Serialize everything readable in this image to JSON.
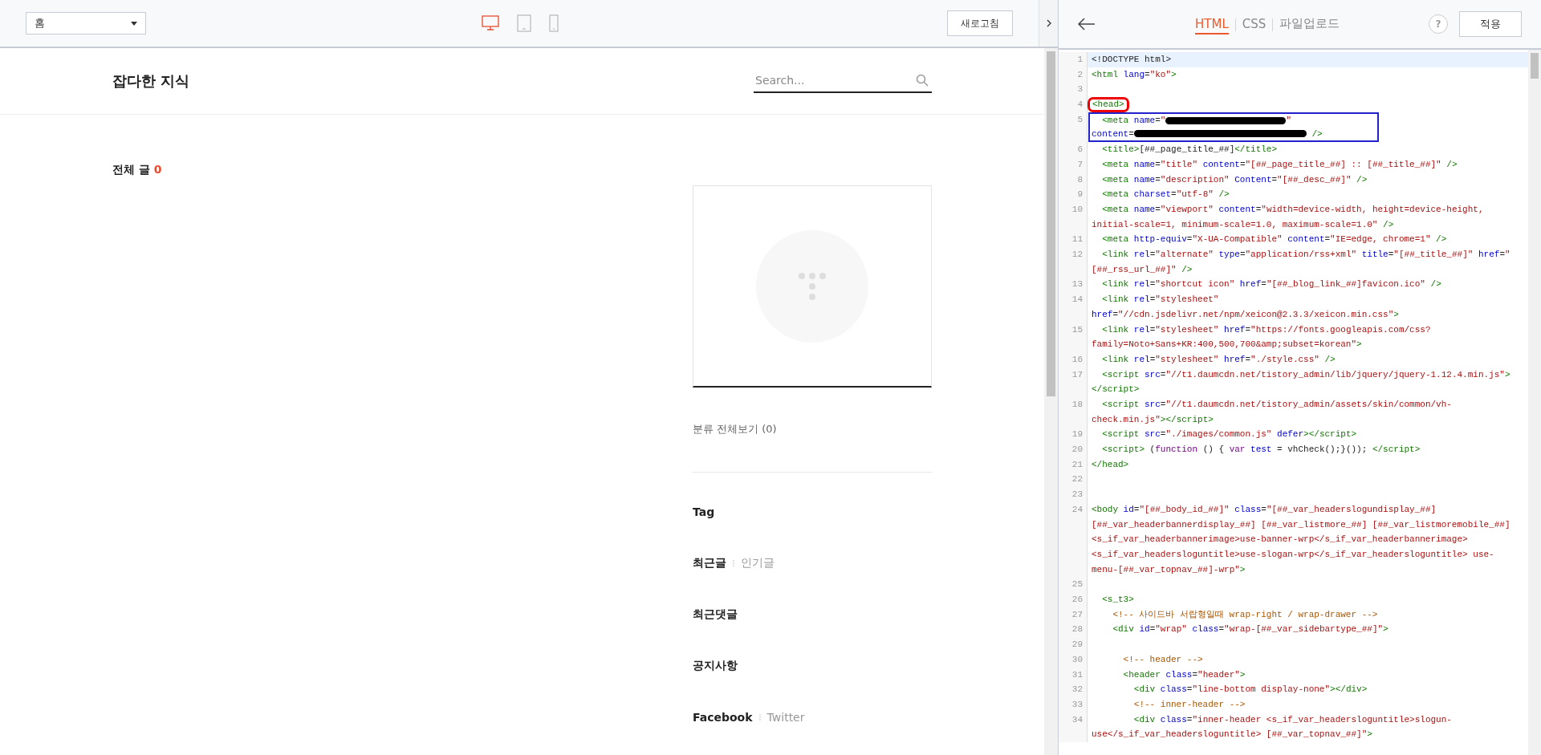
{
  "preview_toolbar": {
    "page_select": {
      "value": "홈"
    },
    "devices": [
      {
        "kind": "desktop",
        "selected": true
      },
      {
        "kind": "tablet",
        "selected": false
      },
      {
        "kind": "mobile",
        "selected": false
      }
    ],
    "refresh_button": "새로고침"
  },
  "blog": {
    "title": "잡다한 지식",
    "search": {
      "placeholder": "Search..."
    },
    "post_count": {
      "label": "전체 글",
      "count": "0"
    },
    "sidebar": {
      "category_link": "분류 전체보기 (0)",
      "sections": [
        {
          "tabs": [
            {
              "label": "Tag",
              "selected": true
            }
          ]
        },
        {
          "tabs": [
            {
              "label": "최근글",
              "selected": true
            },
            {
              "label": "인기글",
              "selected": false
            }
          ]
        },
        {
          "tabs": [
            {
              "label": "최근댓글",
              "selected": true
            }
          ]
        },
        {
          "tabs": [
            {
              "label": "공지사항",
              "selected": true
            }
          ]
        },
        {
          "tabs": [
            {
              "label": "Facebook",
              "selected": true
            },
            {
              "label": "Twitter",
              "selected": false
            }
          ]
        }
      ]
    }
  },
  "editor": {
    "tabs": [
      {
        "label": "HTML",
        "selected": true
      },
      {
        "label": "CSS",
        "selected": false
      },
      {
        "label": "파일업로드",
        "selected": false
      }
    ],
    "help_button": "?",
    "apply_button": "적용",
    "lines": [
      {
        "number": "1",
        "current": true,
        "circled": false,
        "boxed": false,
        "rows": [
          {
            "tokens": [
              {
                "kind": "plain",
                "text": "<!DOCTYPE html>"
              }
            ]
          }
        ]
      },
      {
        "number": "2",
        "current": false,
        "circled": false,
        "boxed": false,
        "rows": [
          {
            "tokens": [
              {
                "kind": "tag",
                "text": "<html"
              },
              {
                "kind": "attr",
                "text": " lang"
              },
              {
                "kind": "plain",
                "text": "="
              },
              {
                "kind": "string",
                "text": "\"ko\""
              },
              {
                "kind": "tag",
                "text": ">"
              }
            ]
          }
        ]
      },
      {
        "number": "3",
        "current": false,
        "circled": false,
        "boxed": false,
        "rows": [
          {}
        ]
      },
      {
        "number": "4",
        "current": false,
        "circled": true,
        "boxed": false,
        "rows": [
          {
            "tokens": [
              {
                "kind": "tag",
                "text": "<head>"
              }
            ]
          }
        ]
      },
      {
        "number": "5",
        "current": false,
        "circled": false,
        "boxed": true,
        "rows": [
          {
            "tokens": [
              {
                "kind": "tag",
                "text": "  <meta"
              },
              {
                "kind": "attr",
                "text": " name"
              },
              {
                "kind": "plain",
                "text": "="
              },
              {
                "kind": "string",
                "text": "\""
              },
              {
                "kind": "redaction"
              },
              {
                "kind": "string",
                "text": "\""
              }
            ]
          },
          {
            "tokens": [
              {
                "kind": "attr",
                "text": "content"
              },
              {
                "kind": "plain",
                "text": "="
              },
              {
                "kind": "redaction"
              },
              {
                "kind": "tag",
                "text": " />"
              }
            ]
          }
        ]
      },
      {
        "number": "6",
        "current": false,
        "circled": false,
        "boxed": false,
        "rows": [
          {
            "tokens": [
              {
                "kind": "tag",
                "text": "  <title>"
              },
              {
                "kind": "plain",
                "text": "[##_page_title_##]"
              },
              {
                "kind": "tag",
                "text": "</title>"
              }
            ]
          }
        ]
      },
      {
        "number": "7",
        "current": false,
        "circled": false,
        "boxed": false,
        "rows": [
          {
            "tokens": [
              {
                "kind": "tag",
                "text": "  <meta"
              },
              {
                "kind": "attr",
                "text": " name"
              },
              {
                "kind": "plain",
                "text": "="
              },
              {
                "kind": "string",
                "text": "\"title\""
              },
              {
                "kind": "attr",
                "text": " content"
              },
              {
                "kind": "plain",
                "text": "="
              },
              {
                "kind": "string",
                "text": "\"[##_page_title_##] :: [##_title_##]\""
              },
              {
                "kind": "tag",
                "text": " />"
              }
            ]
          }
        ]
      },
      {
        "number": "8",
        "current": false,
        "circled": false,
        "boxed": false,
        "rows": [
          {
            "tokens": [
              {
                "kind": "tag",
                "text": "  <meta"
              },
              {
                "kind": "attr",
                "text": " name"
              },
              {
                "kind": "plain",
                "text": "="
              },
              {
                "kind": "string",
                "text": "\"description\""
              },
              {
                "kind": "attr",
                "text": " Content"
              },
              {
                "kind": "plain",
                "text": "="
              },
              {
                "kind": "string",
                "text": "\"[##_desc_##]\""
              },
              {
                "kind": "tag",
                "text": " />"
              }
            ]
          }
        ]
      },
      {
        "number": "9",
        "current": false,
        "circled": false,
        "boxed": false,
        "rows": [
          {
            "tokens": [
              {
                "kind": "tag",
                "text": "  <meta"
              },
              {
                "kind": "attr",
                "text": " charset"
              },
              {
                "kind": "plain",
                "text": "="
              },
              {
                "kind": "string",
                "text": "\"utf-8\""
              },
              {
                "kind": "tag",
                "text": " />"
              }
            ]
          }
        ]
      },
      {
        "number": "10",
        "current": false,
        "circled": false,
        "boxed": false,
        "rows": [
          {
            "tokens": [
              {
                "kind": "tag",
                "text": "  <meta"
              },
              {
                "kind": "attr",
                "text": " name"
              },
              {
                "kind": "plain",
                "text": "="
              },
              {
                "kind": "string",
                "text": "\"viewport\""
              },
              {
                "kind": "attr",
                "text": " content"
              },
              {
                "kind": "plain",
                "text": "="
              },
              {
                "kind": "string",
                "text": "\"width=device-width, height=device-height,"
              }
            ]
          },
          {
            "tokens": [
              {
                "kind": "string",
                "text": "initial-scale=1, minimum-scale=1.0, maximum-scale=1.0\""
              },
              {
                "kind": "tag",
                "text": " />"
              }
            ]
          }
        ]
      },
      {
        "number": "11",
        "current": false,
        "circled": false,
        "boxed": false,
        "rows": [
          {
            "tokens": [
              {
                "kind": "tag",
                "text": "  <meta"
              },
              {
                "kind": "attr",
                "text": " http-equiv"
              },
              {
                "kind": "plain",
                "text": "="
              },
              {
                "kind": "string",
                "text": "\"X-UA-Compatible\""
              },
              {
                "kind": "attr",
                "text": " content"
              },
              {
                "kind": "plain",
                "text": "="
              },
              {
                "kind": "string",
                "text": "\"IE=edge, chrome=1\""
              },
              {
                "kind": "tag",
                "text": " />"
              }
            ]
          }
        ]
      },
      {
        "number": "12",
        "current": false,
        "circled": false,
        "boxed": false,
        "rows": [
          {
            "tokens": [
              {
                "kind": "tag",
                "text": "  <link"
              },
              {
                "kind": "attr",
                "text": " rel"
              },
              {
                "kind": "plain",
                "text": "="
              },
              {
                "kind": "string",
                "text": "\"alternate\""
              },
              {
                "kind": "attr",
                "text": " type"
              },
              {
                "kind": "plain",
                "text": "="
              },
              {
                "kind": "string",
                "text": "\"application/rss+xml\""
              },
              {
                "kind": "attr",
                "text": " title"
              },
              {
                "kind": "plain",
                "text": "="
              },
              {
                "kind": "string",
                "text": "\"[##_title_##]\""
              },
              {
                "kind": "attr",
                "text": " href"
              },
              {
                "kind": "plain",
                "text": "="
              },
              {
                "kind": "string",
                "text": "\""
              }
            ]
          },
          {
            "tokens": [
              {
                "kind": "string",
                "text": "[##_rss_url_##]\""
              },
              {
                "kind": "tag",
                "text": " />"
              }
            ]
          }
        ]
      },
      {
        "number": "13",
        "current": false,
        "circled": false,
        "boxed": false,
        "rows": [
          {
            "tokens": [
              {
                "kind": "tag",
                "text": "  <link"
              },
              {
                "kind": "attr",
                "text": " rel"
              },
              {
                "kind": "plain",
                "text": "="
              },
              {
                "kind": "string",
                "text": "\"shortcut icon\""
              },
              {
                "kind": "attr",
                "text": " href"
              },
              {
                "kind": "plain",
                "text": "="
              },
              {
                "kind": "string",
                "text": "\"[##_blog_link_##]favicon.ico\""
              },
              {
                "kind": "tag",
                "text": " />"
              }
            ]
          }
        ]
      },
      {
        "number": "14",
        "current": false,
        "circled": false,
        "boxed": false,
        "rows": [
          {
            "tokens": [
              {
                "kind": "tag",
                "text": "  <link"
              },
              {
                "kind": "attr",
                "text": " rel"
              },
              {
                "kind": "plain",
                "text": "="
              },
              {
                "kind": "string",
                "text": "\"stylesheet\""
              }
            ]
          },
          {
            "tokens": [
              {
                "kind": "attr",
                "text": "href"
              },
              {
                "kind": "plain",
                "text": "="
              },
              {
                "kind": "string",
                "text": "\"//cdn.jsdelivr.net/npm/xeicon@2.3.3/xeicon.min.css\""
              },
              {
                "kind": "tag",
                "text": ">"
              }
            ]
          }
        ]
      },
      {
        "number": "15",
        "current": false,
        "circled": false,
        "boxed": false,
        "rows": [
          {
            "tokens": [
              {
                "kind": "tag",
                "text": "  <link"
              },
              {
                "kind": "attr",
                "text": " rel"
              },
              {
                "kind": "plain",
                "text": "="
              },
              {
                "kind": "string",
                "text": "\"stylesheet\""
              },
              {
                "kind": "attr",
                "text": " href"
              },
              {
                "kind": "plain",
                "text": "="
              },
              {
                "kind": "string",
                "text": "\"https://fonts.googleapis.com/css?"
              }
            ]
          },
          {
            "tokens": [
              {
                "kind": "string",
                "text": "family=Noto+Sans+KR:400,500,700&amp;subset=korean\""
              },
              {
                "kind": "tag",
                "text": ">"
              }
            ]
          }
        ]
      },
      {
        "number": "16",
        "current": false,
        "circled": false,
        "boxed": false,
        "rows": [
          {
            "tokens": [
              {
                "kind": "tag",
                "text": "  <link"
              },
              {
                "kind": "attr",
                "text": " rel"
              },
              {
                "kind": "plain",
                "text": "="
              },
              {
                "kind": "string",
                "text": "\"stylesheet\""
              },
              {
                "kind": "attr",
                "text": " href"
              },
              {
                "kind": "plain",
                "text": "="
              },
              {
                "kind": "string",
                "text": "\"./style.css\""
              },
              {
                "kind": "tag",
                "text": " />"
              }
            ]
          }
        ]
      },
      {
        "number": "17",
        "current": false,
        "circled": false,
        "boxed": false,
        "rows": [
          {
            "tokens": [
              {
                "kind": "tag",
                "text": "  <script"
              },
              {
                "kind": "attr",
                "text": " src"
              },
              {
                "kind": "plain",
                "text": "="
              },
              {
                "kind": "string",
                "text": "\"//t1.daumcdn.net/tistory_admin/lib/jquery/jquery-1.12.4.min.js\""
              },
              {
                "kind": "tag",
                "text": ">"
              }
            ]
          },
          {
            "tokens": [
              {
                "kind": "tag",
                "text": "</script>"
              }
            ]
          }
        ]
      },
      {
        "number": "18",
        "current": false,
        "circled": false,
        "boxed": false,
        "rows": [
          {
            "tokens": [
              {
                "kind": "tag",
                "text": "  <script"
              },
              {
                "kind": "attr",
                "text": " src"
              },
              {
                "kind": "plain",
                "text": "="
              },
              {
                "kind": "string",
                "text": "\"//t1.daumcdn.net/tistory_admin/assets/skin/common/vh-"
              }
            ]
          },
          {
            "tokens": [
              {
                "kind": "string",
                "text": "check.min.js\""
              },
              {
                "kind": "tag",
                "text": "></script>"
              }
            ]
          }
        ]
      },
      {
        "number": "19",
        "current": false,
        "circled": false,
        "boxed": false,
        "rows": [
          {
            "tokens": [
              {
                "kind": "tag",
                "text": "  <script"
              },
              {
                "kind": "attr",
                "text": " src"
              },
              {
                "kind": "plain",
                "text": "="
              },
              {
                "kind": "string",
                "text": "\"./images/common.js\""
              },
              {
                "kind": "attr",
                "text": " defer"
              },
              {
                "kind": "tag",
                "text": "></script>"
              }
            ]
          }
        ]
      },
      {
        "number": "20",
        "current": false,
        "circled": false,
        "boxed": false,
        "rows": [
          {
            "tokens": [
              {
                "kind": "tag",
                "text": "  <script>"
              },
              {
                "kind": "plain",
                "text": " ("
              },
              {
                "kind": "keyword",
                "text": "function"
              },
              {
                "kind": "plain",
                "text": " () { "
              },
              {
                "kind": "keyword",
                "text": "var"
              },
              {
                "kind": "attr",
                "text": " test"
              },
              {
                "kind": "plain",
                "text": " = vhCheck();}()); "
              },
              {
                "kind": "tag",
                "text": "</script>"
              }
            ]
          }
        ]
      },
      {
        "number": "21",
        "current": false,
        "circled": false,
        "boxed": false,
        "rows": [
          {
            "tokens": [
              {
                "kind": "tag",
                "text": "</head>"
              }
            ]
          }
        ]
      },
      {
        "number": "22",
        "current": false,
        "circled": false,
        "boxed": false,
        "rows": [
          {}
        ]
      },
      {
        "number": "23",
        "current": false,
        "circled": false,
        "boxed": false,
        "rows": [
          {}
        ]
      },
      {
        "number": "24",
        "current": false,
        "circled": false,
        "boxed": false,
        "rows": [
          {
            "tokens": [
              {
                "kind": "tag",
                "text": "<body"
              },
              {
                "kind": "attr",
                "text": " id"
              },
              {
                "kind": "plain",
                "text": "="
              },
              {
                "kind": "string",
                "text": "\"[##_body_id_##]\""
              },
              {
                "kind": "attr",
                "text": " class"
              },
              {
                "kind": "plain",
                "text": "="
              },
              {
                "kind": "string",
                "text": "\"[##_var_headerslogundisplay_##]"
              }
            ]
          },
          {
            "tokens": [
              {
                "kind": "string",
                "text": "[##_var_headerbannerdisplay_##] [##_var_listmore_##] [##_var_listmoremobile_##]"
              }
            ]
          },
          {
            "tokens": [
              {
                "kind": "string",
                "text": "<s_if_var_headerbannerimage>use-banner-wrp</s_if_var_headerbannerimage>"
              }
            ]
          },
          {
            "tokens": [
              {
                "kind": "string",
                "text": "<s_if_var_headersloguntitle>use-slogan-wrp</s_if_var_headersloguntitle> use-"
              }
            ]
          },
          {
            "tokens": [
              {
                "kind": "string",
                "text": "menu-[##_var_topnav_##]-wrp\""
              },
              {
                "kind": "tag",
                "text": ">"
              }
            ]
          }
        ]
      },
      {
        "number": "25",
        "current": false,
        "circled": false,
        "boxed": false,
        "rows": [
          {}
        ]
      },
      {
        "number": "26",
        "current": false,
        "circled": false,
        "boxed": false,
        "rows": [
          {
            "tokens": [
              {
                "kind": "tag",
                "text": "  <s_t3>"
              }
            ]
          }
        ]
      },
      {
        "number": "27",
        "current": false,
        "circled": false,
        "boxed": false,
        "rows": [
          {
            "tokens": [
              {
                "kind": "comment",
                "text": "    <!-- 사이드바 서랍형일때 wrap-right / wrap-drawer -->"
              }
            ]
          }
        ]
      },
      {
        "number": "28",
        "current": false,
        "circled": false,
        "boxed": false,
        "rows": [
          {
            "tokens": [
              {
                "kind": "tag",
                "text": "    <div"
              },
              {
                "kind": "attr",
                "text": " id"
              },
              {
                "kind": "plain",
                "text": "="
              },
              {
                "kind": "string",
                "text": "\"wrap\""
              },
              {
                "kind": "attr",
                "text": " class"
              },
              {
                "kind": "plain",
                "text": "="
              },
              {
                "kind": "string",
                "text": "\"wrap-[##_var_sidebartype_##]\""
              },
              {
                "kind": "tag",
                "text": ">"
              }
            ]
          }
        ]
      },
      {
        "number": "29",
        "current": false,
        "circled": false,
        "boxed": false,
        "rows": [
          {}
        ]
      },
      {
        "number": "30",
        "current": false,
        "circled": false,
        "boxed": false,
        "rows": [
          {
            "tokens": [
              {
                "kind": "comment",
                "text": "      <!-- header -->"
              }
            ]
          }
        ]
      },
      {
        "number": "31",
        "current": false,
        "circled": false,
        "boxed": false,
        "rows": [
          {
            "tokens": [
              {
                "kind": "tag",
                "text": "      <header"
              },
              {
                "kind": "attr",
                "text": " class"
              },
              {
                "kind": "plain",
                "text": "="
              },
              {
                "kind": "string",
                "text": "\"header\""
              },
              {
                "kind": "tag",
                "text": ">"
              }
            ]
          }
        ]
      },
      {
        "number": "32",
        "current": false,
        "circled": false,
        "boxed": false,
        "rows": [
          {
            "tokens": [
              {
                "kind": "tag",
                "text": "        <div"
              },
              {
                "kind": "attr",
                "text": " class"
              },
              {
                "kind": "plain",
                "text": "="
              },
              {
                "kind": "string",
                "text": "\"line-bottom display-none\""
              },
              {
                "kind": "tag",
                "text": "></div>"
              }
            ]
          }
        ]
      },
      {
        "number": "33",
        "current": false,
        "circled": false,
        "boxed": false,
        "rows": [
          {
            "tokens": [
              {
                "kind": "comment",
                "text": "        <!-- inner-header -->"
              }
            ]
          }
        ]
      },
      {
        "number": "34",
        "current": false,
        "circled": false,
        "boxed": false,
        "rows": [
          {
            "tokens": [
              {
                "kind": "tag",
                "text": "        <div"
              },
              {
                "kind": "attr",
                "text": " class"
              },
              {
                "kind": "plain",
                "text": "="
              },
              {
                "kind": "string",
                "text": "\"inner-header <s_if_var_headersloguntitle>slogun-"
              }
            ]
          },
          {
            "tokens": [
              {
                "kind": "string",
                "text": "use</s_if_var_headersloguntitle> [##_var_topnav_##]\""
              },
              {
                "kind": "tag",
                "text": ">"
              }
            ]
          }
        ]
      }
    ]
  }
}
